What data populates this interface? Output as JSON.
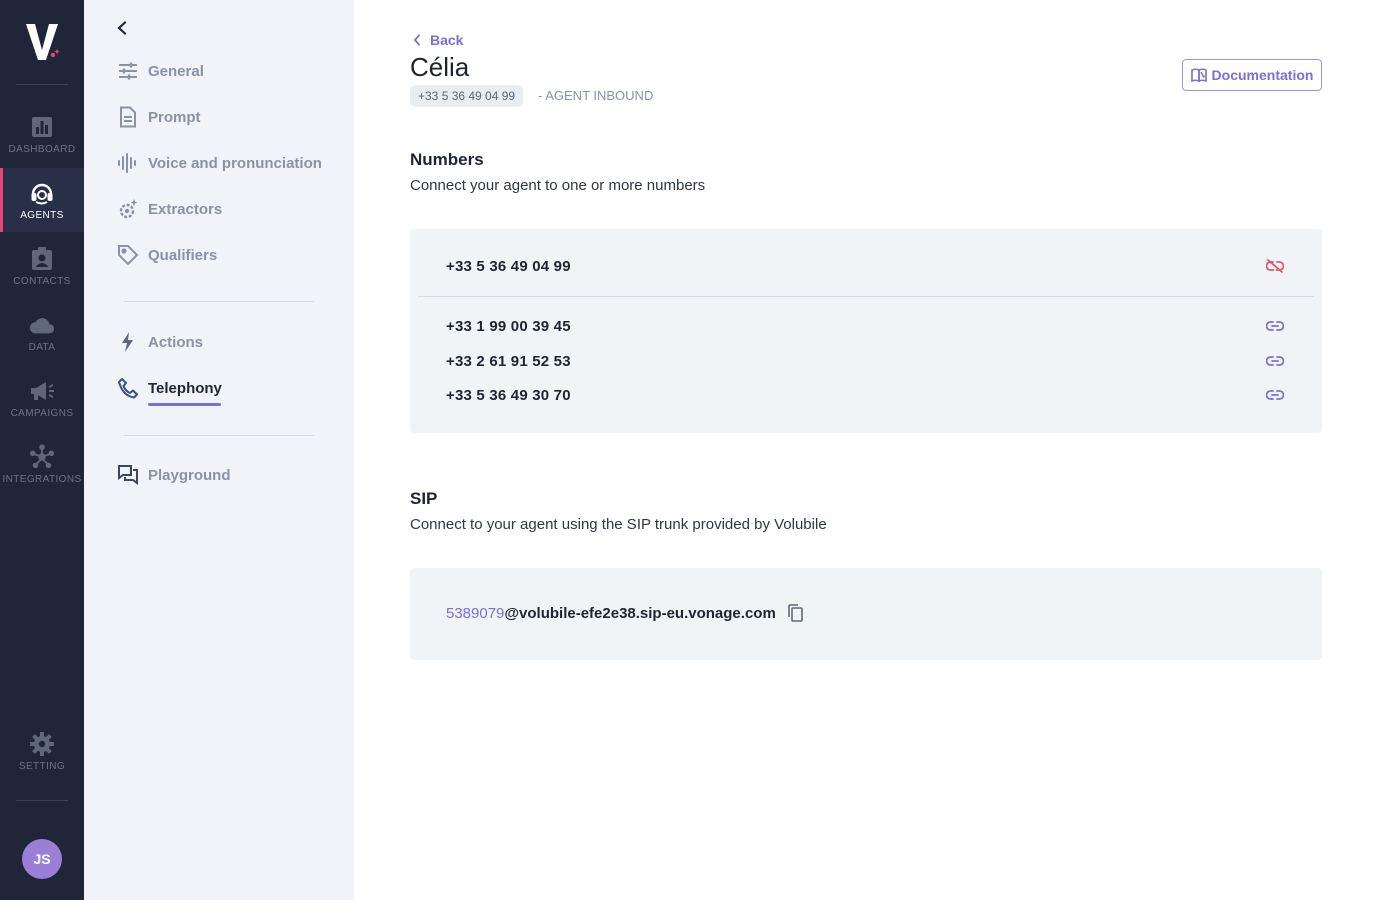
{
  "rail": {
    "logo_text": "V.",
    "items": [
      {
        "label": "DASHBOARD",
        "icon": "bar-chart-icon"
      },
      {
        "label": "AGENTS",
        "icon": "headset-icon"
      },
      {
        "label": "CONTACTS",
        "icon": "contact-card-icon"
      },
      {
        "label": "DATA",
        "icon": "cloud-icon"
      },
      {
        "label": "CAMPAIGNS",
        "icon": "megaphone-icon"
      },
      {
        "label": "INTEGRATIONS",
        "icon": "hub-icon"
      }
    ],
    "active": "AGENTS",
    "settings_label": "SETTING",
    "avatar_initials": "JS"
  },
  "subnav": {
    "items": [
      {
        "label": "General",
        "icon": "sliders-icon"
      },
      {
        "label": "Prompt",
        "icon": "document-icon"
      },
      {
        "label": "Voice and pronunciation",
        "icon": "waveform-icon"
      },
      {
        "label": "Extractors",
        "icon": "gear-sparkle-icon"
      },
      {
        "label": "Qualifiers",
        "icon": "tag-icon"
      },
      {
        "label": "Actions",
        "icon": "lightning-icon"
      },
      {
        "label": "Telephony",
        "icon": "phone-icon"
      },
      {
        "label": "Playground",
        "icon": "chat-icon"
      }
    ],
    "active": "Telephony"
  },
  "header": {
    "back_label": "Back",
    "agent_name": "Célia",
    "phone_chip": "+33 5 36 49 04 99",
    "agent_type": "- AGENT INBOUND",
    "documentation_label": "Documentation"
  },
  "numbers": {
    "title": "Numbers",
    "subtitle": "Connect your agent to one or more numbers",
    "connected": "+33 5 36 49 04 99",
    "available": [
      "+33 1 99 00 39 45",
      "+33 2 61 91 52 53",
      "+33 5 36 49 30 70"
    ]
  },
  "sip": {
    "title": "SIP",
    "subtitle": "Connect to your agent using the SIP trunk provided by Volubile",
    "user": "5389079",
    "domain": "@volubile-efe2e38.sip-eu.vonage.com"
  },
  "colors": {
    "accent": "#7b6fd3",
    "rail_bg": "#1f2637",
    "active_marker": "#e8457a",
    "unlink": "#e0566a"
  }
}
